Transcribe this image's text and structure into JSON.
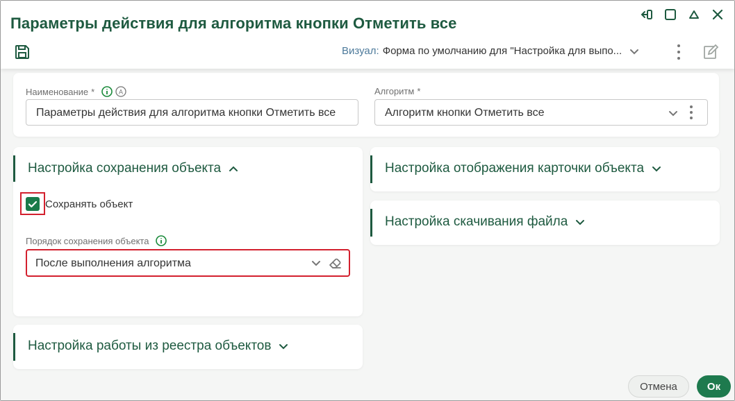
{
  "window": {
    "title": "Параметры действия для алгоритма кнопки Отметить все"
  },
  "toolbar": {
    "visual_label": "Визуал:",
    "visual_value": "Форма по умолчанию для \"Настройка для выпо..."
  },
  "fields": {
    "name": {
      "label": "Наименование",
      "required_mark": "*",
      "value": "Параметры действия для алгоритма кнопки Отметить все"
    },
    "algorithm": {
      "label": "Алгоритм",
      "required_mark": "*",
      "value": "Алгоритм кнопки Отметить все"
    }
  },
  "sections": {
    "save": {
      "title": "Настройка сохранения объекта",
      "expanded": true,
      "checkbox_label": "Сохранять объект",
      "checkbox_checked": true,
      "order_label": "Порядок сохранения объекта",
      "order_value": "После выполнения алгоритма"
    },
    "registry": {
      "title": "Настройка работы из реестра объектов",
      "expanded": false
    },
    "card_display": {
      "title": "Настройка отображения карточки объекта",
      "expanded": false
    },
    "download": {
      "title": "Настройка скачивания файла",
      "expanded": false
    }
  },
  "footer": {
    "cancel_label": "Отмена",
    "ok_label": "Ок"
  },
  "colors": {
    "accent": "#1e5a40",
    "primary_button": "#1e7a4e",
    "highlight": "#d3202e"
  },
  "icons": [
    "pin-icon",
    "maximize-icon",
    "collapse-icon",
    "close-icon",
    "save-icon",
    "chevron-down-icon",
    "more-icon",
    "edit-icon",
    "info-icon",
    "auto-icon",
    "chevron-up-icon",
    "check-icon",
    "eraser-icon"
  ]
}
